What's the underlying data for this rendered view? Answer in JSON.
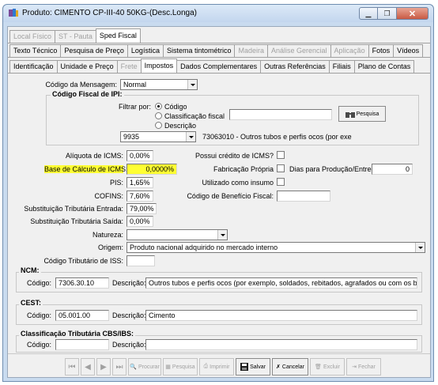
{
  "window": {
    "title": "Produto: CIMENTO CP-III-40 50KG-(Desc.Longa)"
  },
  "tabs_row1": [
    {
      "label": "Local Físico",
      "disabled": true
    },
    {
      "label": "ST - Pauta",
      "disabled": true
    },
    {
      "label": "Sped Fiscal",
      "active": true
    }
  ],
  "tabs_row2": [
    {
      "label": "Texto Técnico"
    },
    {
      "label": "Pesquisa de Preço"
    },
    {
      "label": "Logística"
    },
    {
      "label": "Sistema tintométrico"
    },
    {
      "label": "Madeira",
      "disabled": true
    },
    {
      "label": "Análise Gerencial",
      "disabled": true
    },
    {
      "label": "Aplicação",
      "disabled": true
    },
    {
      "label": "Fotos"
    },
    {
      "label": "Vídeos"
    }
  ],
  "tabs_row3": [
    {
      "label": "Identificação"
    },
    {
      "label": "Unidade e Preço"
    },
    {
      "label": "Frete",
      "disabled": true
    },
    {
      "label": "Impostos",
      "active": true
    },
    {
      "label": "Dados Complementares"
    },
    {
      "label": "Outras Referências"
    },
    {
      "label": "Filiais"
    },
    {
      "label": "Plano de Contas"
    }
  ],
  "form": {
    "codigo_mensagem_label": "Código da Mensagem:",
    "codigo_mensagem_value": "Normal",
    "ipi_group_label": "Código Fiscal de IPI:",
    "filtrar_por_label": "Filtrar por:",
    "radio_codigo": "Código",
    "radio_classificacao": "Classificação fiscal",
    "radio_descricao": "Descrição",
    "pesquisa_button": "Pesquisa",
    "ipi_code": "9935",
    "ipi_desc": "73063010 - Outros tubos e perfis ocos (por exe",
    "aliquota_icms_label": "Alíquota de ICMS:",
    "aliquota_icms_value": "0,00%",
    "base_calculo_label": "Base de Cálculo de ICMS:",
    "base_calculo_value": "0,0000%",
    "pis_label": "PIS:",
    "pis_value": "1,65%",
    "cofins_label": "COFINS:",
    "cofins_value": "7,60%",
    "st_entrada_label": "Substituição Tributária Entrada:",
    "st_entrada_value": "79,00%",
    "st_saida_label": "Substituição Tributária Saída:",
    "st_saida_value": "0,00%",
    "credito_icms_label": "Possui crédito de ICMS?",
    "fabricacao_label": "Fabricação Própria",
    "dias_producao_label": "Dias para Produção/Entrega:",
    "dias_producao_value": "0",
    "utilizado_insumo_label": "Utilizado como insumo",
    "beneficio_fiscal_label": "Código de Benefício Fiscal:",
    "natureza_label": "Natureza:",
    "natureza_value": "",
    "origem_label": "Origem:",
    "origem_value": "Produto nacional adquirido no mercado interno",
    "iss_label": "Código Tributário de ISS:"
  },
  "ncm": {
    "title": "NCM:",
    "codigo_label": "Código:",
    "codigo_value": "7306.30.10",
    "descricao_label": "Descrição:",
    "descricao_value": "Outros tubos e perfis ocos (por exemplo, soldados, rebitados, agrafados ou com os bordos sin"
  },
  "cest": {
    "title": "CEST:",
    "codigo_label": "Código:",
    "codigo_value": "05.001.00",
    "descricao_label": "Descrição:",
    "descricao_value": "Cimento"
  },
  "cbs": {
    "title": "Classificação Tributária CBS/IBS:",
    "codigo_label": "Código:",
    "descricao_label": "Descrição:"
  },
  "toolbar": {
    "procurar": "Procurar",
    "pesquisa": "Pesquisa",
    "imprimir": "Imprimir",
    "salvar": "Salvar",
    "cancelar": "Cancelar",
    "excluir": "Excluir",
    "fechar": "Fechar"
  },
  "colors": {
    "highlight": "#ffff33",
    "window_frame": "#c9dbef",
    "close_button": "#c85a43"
  }
}
